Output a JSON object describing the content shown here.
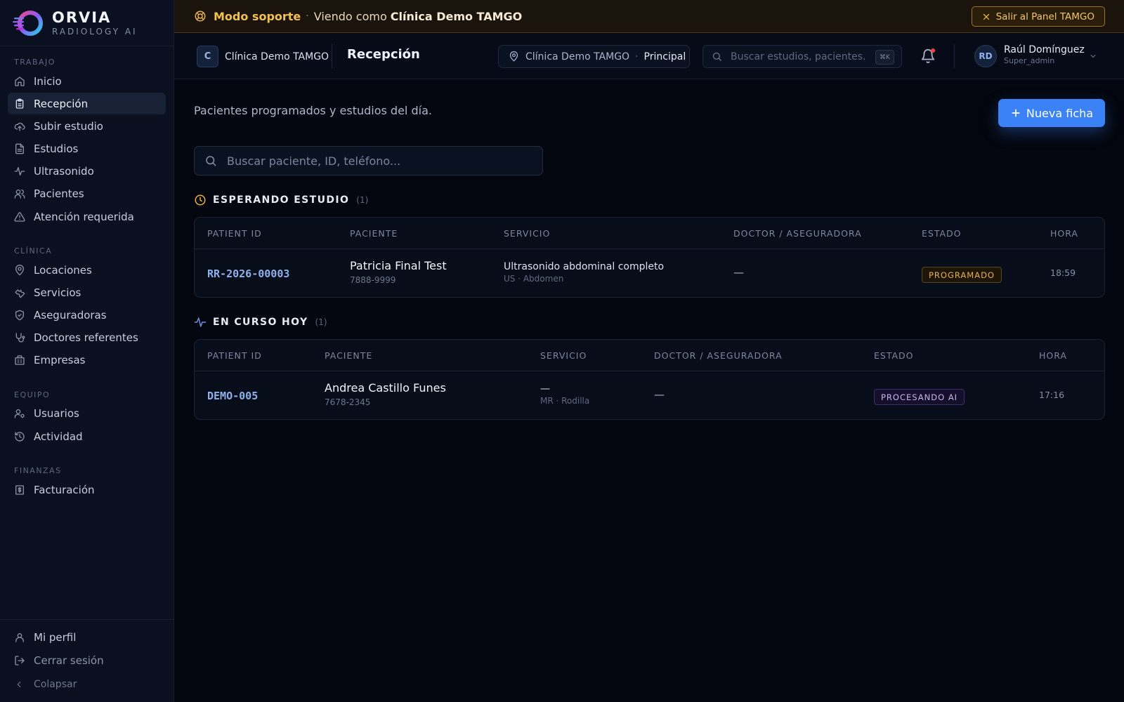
{
  "brand": {
    "name": "ORVIA",
    "subtitle": "RADIOLOGY AI"
  },
  "sidebar": {
    "sections": [
      {
        "title": "TRABAJO",
        "items": [
          {
            "label": "Inicio",
            "icon": "home-icon"
          },
          {
            "label": "Recepción",
            "icon": "clipboard-icon",
            "active": true
          },
          {
            "label": "Subir estudio",
            "icon": "cloud-upload-icon"
          },
          {
            "label": "Estudios",
            "icon": "file-text-icon"
          },
          {
            "label": "Ultrasonido",
            "icon": "activity-icon"
          },
          {
            "label": "Pacientes",
            "icon": "users-icon"
          },
          {
            "label": "Atención requerida",
            "icon": "alert-triangle-icon"
          }
        ]
      },
      {
        "title": "CLÍNICA",
        "items": [
          {
            "label": "Locaciones",
            "icon": "map-pin-icon"
          },
          {
            "label": "Servicios",
            "icon": "wrench-icon"
          },
          {
            "label": "Aseguradoras",
            "icon": "shield-icon"
          },
          {
            "label": "Doctores referentes",
            "icon": "stethoscope-icon"
          },
          {
            "label": "Empresas",
            "icon": "building-icon"
          }
        ]
      },
      {
        "title": "EQUIPO",
        "items": [
          {
            "label": "Usuarios",
            "icon": "user-cog-icon"
          },
          {
            "label": "Actividad",
            "icon": "history-icon"
          }
        ]
      },
      {
        "title": "FINANZAS",
        "items": [
          {
            "label": "Facturación",
            "icon": "receipt-icon"
          }
        ]
      }
    ],
    "bottom": {
      "profile": "Mi perfil",
      "logout": "Cerrar sesión",
      "collapse": "Colapsar"
    }
  },
  "support_banner": {
    "mode": "Modo soporte",
    "separator": "·",
    "viewing": "Viendo como",
    "clinic": "Clínica Demo TAMGO",
    "exit_label": "Salir al Panel TAMGO"
  },
  "header": {
    "clinic_initial": "C",
    "clinic_name": "Clínica Demo TAMGO",
    "page_title": "Recepción",
    "location": {
      "clinic": "Clínica Demo TAMGO",
      "separator": "·",
      "branch": "Principal"
    },
    "search_placeholder": "Buscar estudios, pacientes...",
    "search_shortcut": "⌘K",
    "user": {
      "initials": "RD",
      "name": "Raúl Domínguez",
      "role": "Super_admin"
    }
  },
  "main": {
    "subtitle": "Pacientes programados y estudios del día.",
    "new_button": "Nueva ficha",
    "search_placeholder": "Buscar paciente, ID, teléfono...",
    "waiting": {
      "title": "ESPERANDO ESTUDIO",
      "count": "(1)",
      "accent": "#e8b24a",
      "columns": [
        "PATIENT ID",
        "PACIENTE",
        "SERVICIO",
        "DOCTOR / ASEGURADORA",
        "ESTADO",
        "HORA"
      ],
      "rows": [
        {
          "patient_id": "RR-2026-00003",
          "name": "Patricia Final Test",
          "phone": "7888-9999",
          "service": "Ultrasonido abdominal completo",
          "service_sub": "US · Abdomen",
          "doctor": "—",
          "status": "PROGRAMADO",
          "time": "18:59"
        }
      ]
    },
    "in_progress": {
      "title": "EN CURSO HOY",
      "count": "(1)",
      "accent": "#6f8fe0",
      "columns": [
        "PATIENT ID",
        "PACIENTE",
        "SERVICIO",
        "DOCTOR / ASEGURADORA",
        "ESTADO",
        "HORA"
      ],
      "rows": [
        {
          "patient_id": "DEMO-005",
          "name": "Andrea Castillo Funes",
          "phone": "7678-2345",
          "service": "—",
          "service_sub": "MR · Rodilla",
          "doctor": "—",
          "status": "PROCESANDO AI",
          "time": "17:16"
        }
      ]
    }
  },
  "colors": {
    "accent_blue": "#3b82f6",
    "warning": "#e8b24a",
    "ai_purple": "#c3b8f2",
    "background": "#03060e"
  }
}
